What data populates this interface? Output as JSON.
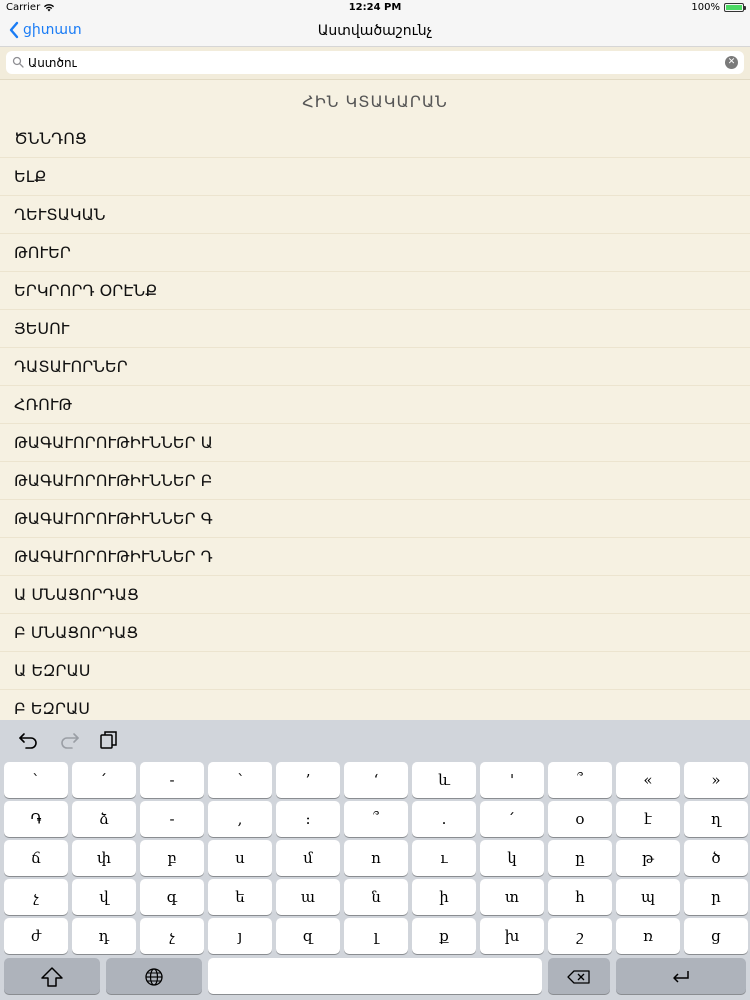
{
  "status_bar": {
    "carrier": "Carrier",
    "time": "12:24 PM",
    "battery": "100%",
    "battery_level": 1.0
  },
  "nav": {
    "back_label": "ցիտատ",
    "title": "Աստվածաշունչ"
  },
  "search": {
    "value": "Աստծու"
  },
  "section_header": "ՀԻՆ ԿՏԱԿԱՐԱՆ",
  "books": [
    "ԾՆՆԴՈՑ",
    "ԵԼՔ",
    "ՂԵՒՏԱԿԱՆ",
    "ԹՈՒԵՐ",
    "ԵՐԿՐՈՐԴ ՕՐԷՆՔ",
    "ՅԵՍՈՒ",
    "ԴԱՏԱՒՈՐՆԵՐ",
    "ՀՌՈՒԹ",
    "ԹԱԳԱՒՈՐՈՒԹԻՒՆՆԵՐ Ա",
    "ԹԱԳԱՒՈՐՈՒԹԻՒՆՆԵՐ Բ",
    "ԹԱԳԱՒՈՐՈՒԹԻՒՆՆԵՐ Գ",
    "ԹԱԳԱՒՈՐՈՒԹԻՒՆՆԵՐ Դ",
    "Ա ՄՆԱՑՈՐԴԱՑ",
    "Բ ՄՆԱՑՈՐԴԱՑ",
    "Ա ԵԶՐԱՍ",
    "Բ ԵԶՐԱՍ"
  ],
  "keyboard": {
    "rows": [
      [
        "`",
        "՛",
        "-",
        "՝",
        "’",
        "‘",
        "և",
        "'",
        "՞",
        "«",
        "»"
      ],
      [
        "֏",
        "ձ",
        "-",
        ",",
        ":",
        "՞",
        ".",
        "՛",
        "օ",
        "է",
        "ղ"
      ],
      [
        "ճ",
        "փ",
        "բ",
        "ս",
        "մ",
        "ո",
        "ւ",
        "կ",
        "ը",
        "թ",
        "ծ"
      ],
      [
        "չ",
        "վ",
        "գ",
        "ե",
        "ա",
        "ն",
        "ի",
        "տ",
        "հ",
        "պ",
        "ր"
      ],
      [
        "ժ",
        "դ",
        "չ",
        "յ",
        "զ",
        "լ",
        "ք",
        "խ",
        "շ",
        "ռ",
        "ց"
      ]
    ],
    "icons": {
      "undo": "undo-icon",
      "redo": "redo-icon",
      "paste": "clipboard-icon",
      "shift": "shift-icon",
      "globe": "globe-icon",
      "delete": "delete-icon",
      "return": "return-icon"
    }
  }
}
